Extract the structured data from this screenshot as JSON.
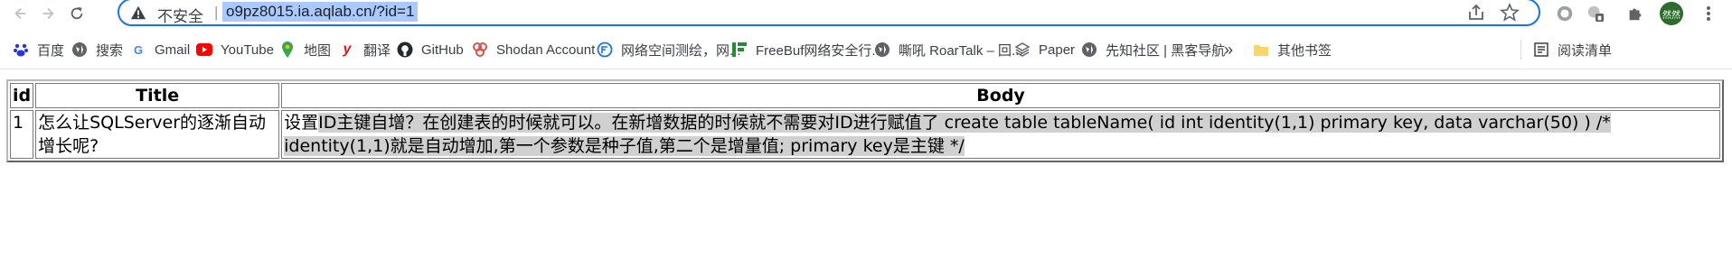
{
  "browser": {
    "insecure_label": "不安全",
    "separator": "|",
    "url": "o9pz8015.ia.aqlab.cn/?id=1",
    "profile_name": "然然"
  },
  "bookmarks": [
    {
      "label": "百度",
      "icon": "baidu-icon",
      "color": "#2932e1"
    },
    {
      "label": "搜索",
      "icon": "globe-icon",
      "color": "#5f6368"
    },
    {
      "label": "Gmail",
      "icon": "google-icon",
      "color": "#4285f4"
    },
    {
      "label": "YouTube",
      "icon": "youtube-icon",
      "color": "#ff0000"
    },
    {
      "label": "地图",
      "icon": "maps-icon",
      "color": "#34a853"
    },
    {
      "label": "翻译",
      "icon": "youdao-icon",
      "color": "#d01e1e"
    },
    {
      "label": "GitHub",
      "icon": "github-icon",
      "color": "#24292e"
    },
    {
      "label": "Shodan Account",
      "icon": "shodan-icon",
      "color": "#d9534f"
    },
    {
      "label": "网络空间测绘，网...",
      "icon": "fofa-icon",
      "color": "#1a73e8"
    },
    {
      "label": "FreeBuf网络安全行...",
      "icon": "freebuf-icon",
      "color": "#2a8a3a"
    },
    {
      "label": "嘶吼 RoarTalk – 回...",
      "icon": "globe-icon",
      "color": "#5f6368"
    },
    {
      "label": "Paper",
      "icon": "paper-icon",
      "color": "#5f6368"
    },
    {
      "label": "先知社区 | 黑客导航",
      "icon": "globe-icon",
      "color": "#5f6368"
    }
  ],
  "bookmarks_more": "»",
  "other_bookmarks": "其他书签",
  "reading_list": "阅读清单",
  "table": {
    "headers": [
      "id",
      "Title",
      "Body"
    ],
    "rows": [
      {
        "id": "1",
        "title": "怎么让SQLServer的逐渐自动增长呢?",
        "body_plain": "设置",
        "body_highlighted": "ID主键自增？在创建表的时候就可以。在新增数据的时候就不需要对ID进行赋值了 create table tableName( id int identity(1,1) primary key, data varchar(50) ) /* identity(1,1)就是自动增加,第一个参数是种子值,第二个是增量值; primary key是主键 */"
      }
    ]
  }
}
